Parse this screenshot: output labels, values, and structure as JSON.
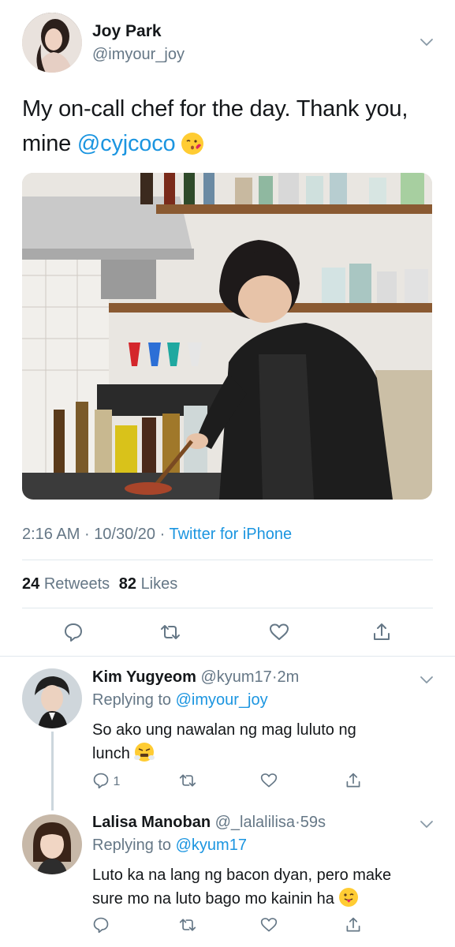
{
  "main_tweet": {
    "author_name": "Joy Park",
    "author_handle": "@imyour_joy",
    "text_line1": "My on-call chef for the day. Thank you,",
    "text_line2_prefix": "mine ",
    "mention": "@cyjcoco",
    "emoji": "kissing-face-emoji",
    "time": "2:16 AM",
    "sep1": "·",
    "date": "10/30/20",
    "sep2": "·",
    "source": "Twitter for iPhone",
    "retweets_count": "24",
    "retweets_label": "Retweets",
    "likes_count": "82",
    "likes_label": "Likes"
  },
  "replies": [
    {
      "author_name": "Kim Yugyeom",
      "author_handle": "@kyum17",
      "dot": "·",
      "time": "2m",
      "replying_label": "Replying to",
      "replying_to": "@imyour_joy",
      "text_line1": "So ako ung nawalan ng mag luluto ng",
      "text_line2": "lunch",
      "emoji": "steam-face-emoji",
      "reply_count": "1"
    },
    {
      "author_name": "Lalisa Manoban",
      "author_handle": "@_lalalilisa",
      "dot": "·",
      "time": "59s",
      "replying_label": "Replying to",
      "replying_to": "@kyum17",
      "text_line1": "Luto ka na lang ng bacon dyan, pero make",
      "text_line2": "sure mo na luto bago mo kainin ha",
      "emoji": "tongue-out-emoji"
    }
  ],
  "colors": {
    "link": "#1b95e0",
    "muted": "#657786",
    "divider": "#e1e8ed",
    "text": "#14171a"
  }
}
